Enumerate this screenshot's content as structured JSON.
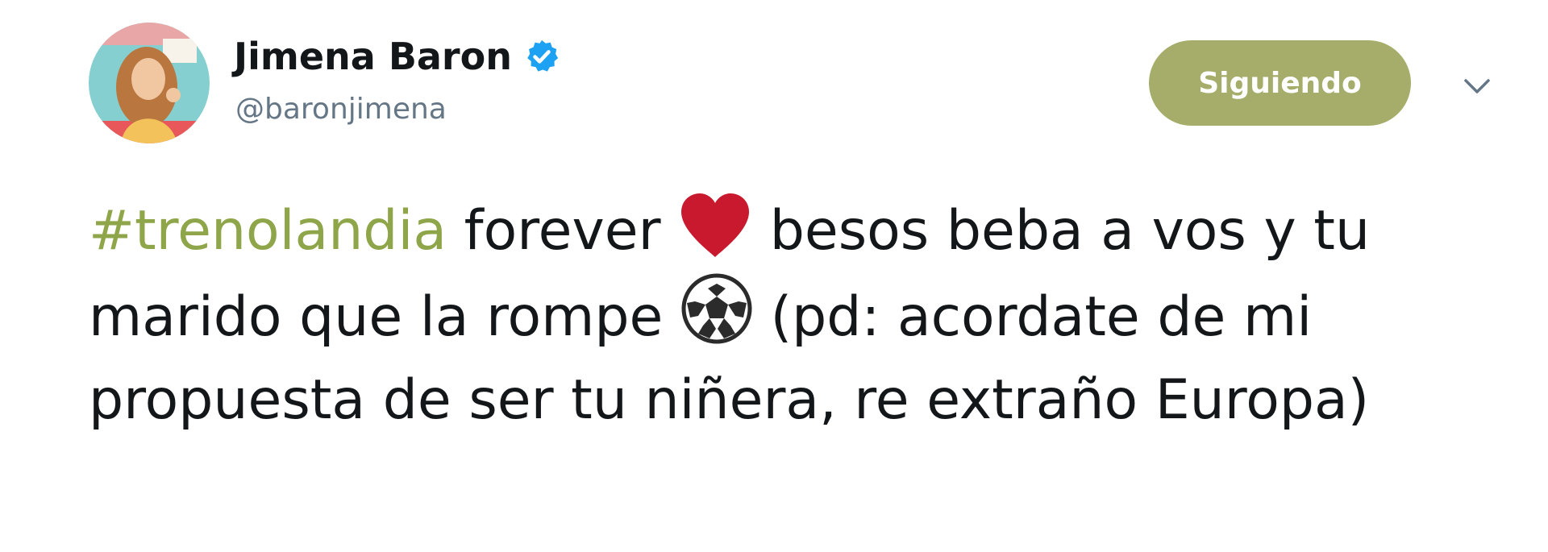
{
  "user": {
    "display_name": "Jimena Baron",
    "handle": "@baronjimena",
    "verified": true
  },
  "follow_button": {
    "label": "Siguiendo"
  },
  "menu": {
    "icon": "chevron-down-icon"
  },
  "tweet": {
    "hashtag": "#trenolandia",
    "text_1": " forever ",
    "emoji_1": "red-heart",
    "text_2": " besos beba a vos y tu marido que la rompe ",
    "emoji_2": "soccer-ball",
    "text_3": " (pd: acordate de mi propuesta de ser tu niñera, re extraño Europa)"
  },
  "colors": {
    "follow_button_bg": "#a6ad6b",
    "hashtag": "#8fa549",
    "handle": "#657786",
    "verified_badge": "#1da1f2",
    "heart": "#c8192e"
  }
}
